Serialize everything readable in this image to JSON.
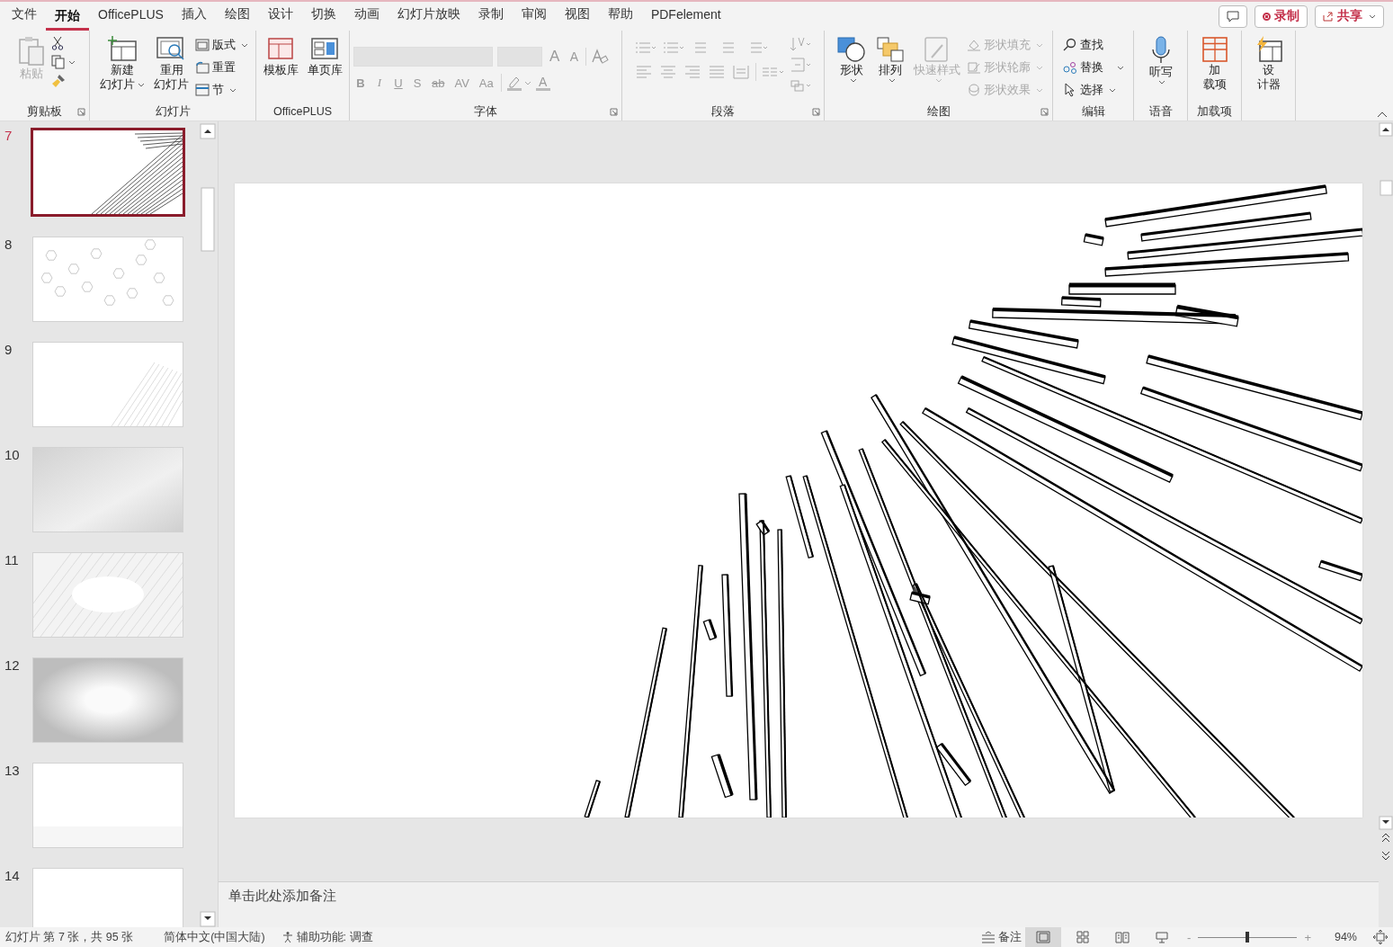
{
  "tabs": [
    {
      "label": "文件",
      "selected": false
    },
    {
      "label": "开始",
      "selected": true
    },
    {
      "label": "OfficePLUS",
      "selected": false
    },
    {
      "label": "插入",
      "selected": false
    },
    {
      "label": "绘图",
      "selected": false
    },
    {
      "label": "设计",
      "selected": false
    },
    {
      "label": "切换",
      "selected": false
    },
    {
      "label": "动画",
      "selected": false
    },
    {
      "label": "幻灯片放映",
      "selected": false
    },
    {
      "label": "录制",
      "selected": false
    },
    {
      "label": "审阅",
      "selected": false
    },
    {
      "label": "视图",
      "selected": false
    },
    {
      "label": "帮助",
      "selected": false
    },
    {
      "label": "PDFelement",
      "selected": false
    }
  ],
  "title_buttons": {
    "record": "录制",
    "share": "共享"
  },
  "clipboard": {
    "paste": {
      "label": "粘贴",
      "disabled": true
    },
    "label": "剪贴板"
  },
  "slides_group": {
    "new": [
      "新建",
      "幻灯片"
    ],
    "reuse": [
      "重用",
      "幻灯片"
    ],
    "layout": "版式",
    "reset": "重置",
    "section": "节",
    "label": "幻灯片"
  },
  "officeplus": {
    "template": "模板库",
    "page": "单页库",
    "label": "OfficePLUS"
  },
  "font": {
    "disabled": true,
    "grow": "A",
    "shrink": "A",
    "styles": [
      "B",
      "I",
      "U",
      "S",
      "ab",
      "AV",
      "Aa"
    ],
    "color_button": "A",
    "label": "字体"
  },
  "paragraph": {
    "disabled": true,
    "label": "段落"
  },
  "drawing": {
    "shapes": "形状",
    "arrange": "排列",
    "quick_styles": {
      "label": "快速样式",
      "disabled": true
    },
    "format": [
      {
        "label": "形状填充",
        "disabled": true
      },
      {
        "label": "形状轮廓",
        "disabled": true
      },
      {
        "label": "形状效果",
        "disabled": true
      }
    ],
    "label": "绘图"
  },
  "editing": {
    "find": "查找",
    "replace": "替换",
    "select": "选择",
    "label": "编辑"
  },
  "voice": {
    "dictate": "听写",
    "label": "语音"
  },
  "addins": {
    "button": [
      "加",
      "载项"
    ],
    "label": "加载项"
  },
  "designer": {
    "button": [
      "设",
      "计器"
    ]
  },
  "slides": [
    {
      "number": "7",
      "selected": true,
      "kind": "rays"
    },
    {
      "number": "8",
      "selected": false,
      "kind": "hexagons"
    },
    {
      "number": "9",
      "selected": false,
      "kind": "streaks"
    },
    {
      "number": "10",
      "selected": false,
      "kind": "gradient"
    },
    {
      "number": "11",
      "selected": false,
      "kind": "hatch"
    },
    {
      "number": "12",
      "selected": false,
      "kind": "vignette"
    },
    {
      "number": "13",
      "selected": false,
      "kind": "plain"
    },
    {
      "number": "14",
      "selected": false,
      "kind": "plain"
    }
  ],
  "notes": {
    "placeholder": "单击此处添加备注"
  },
  "status_bar": {
    "slide_info": "幻灯片 第 7 张，共 95 张",
    "language": "简体中文(中国大陆)",
    "accessibility": "辅助功能: 调查",
    "notes": "备注",
    "views": [
      {
        "kind": "normal",
        "selected": true
      },
      {
        "kind": "sorter",
        "selected": false
      },
      {
        "kind": "reading",
        "selected": false
      },
      {
        "kind": "slideshow",
        "selected": false
      }
    ],
    "zoom_out": "-",
    "zoom_in": "+",
    "zoom": {
      "level": 0.5
    },
    "zoom_text": "94%"
  }
}
